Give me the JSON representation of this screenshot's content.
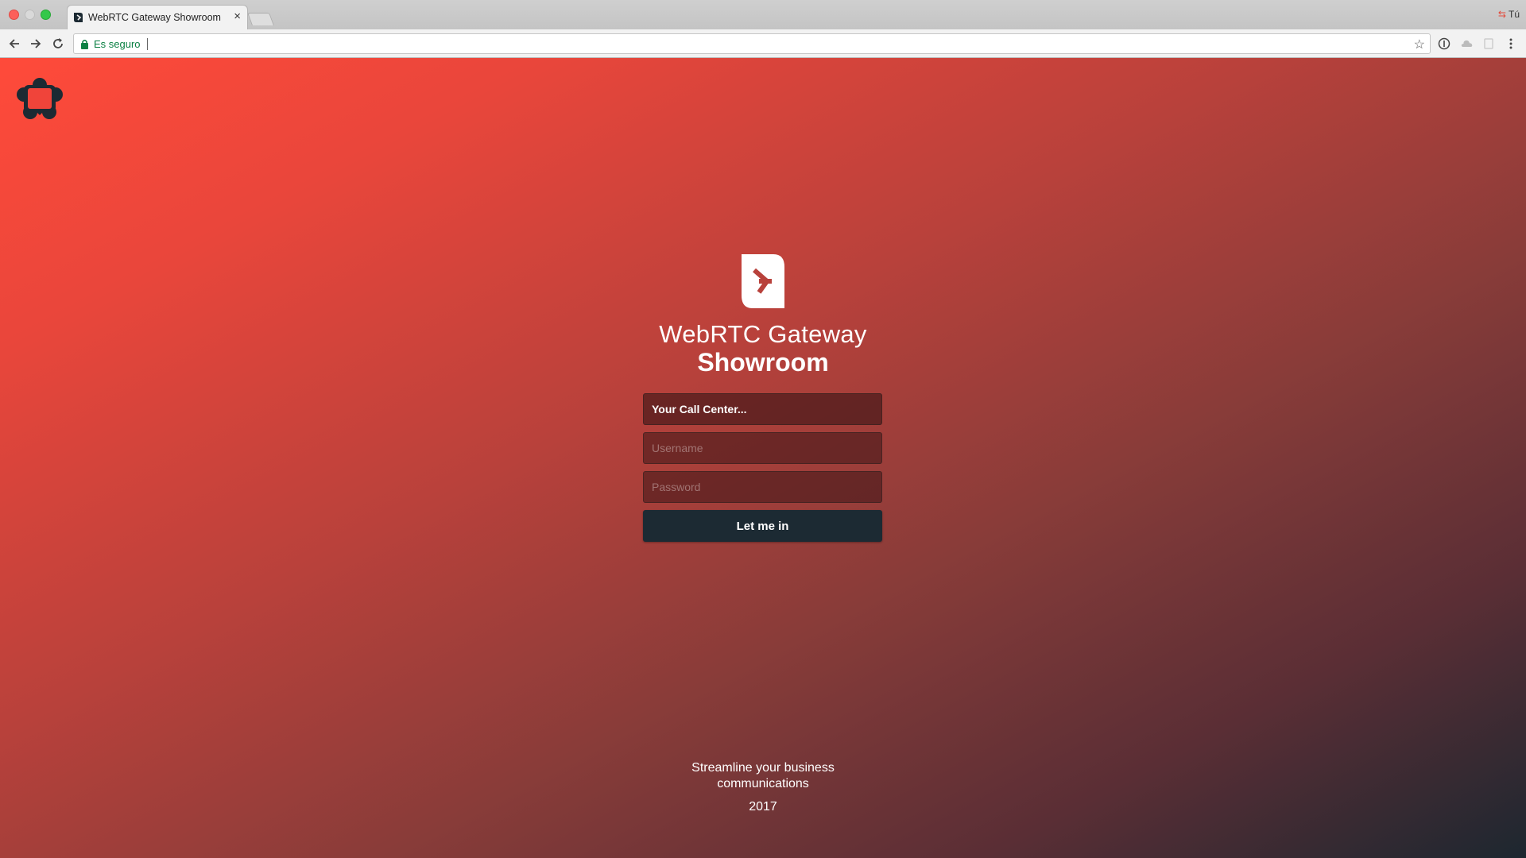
{
  "browser": {
    "tab_title": "WebRTC Gateway Showroom",
    "tab_close": "×",
    "profile_name": "Tú",
    "address": {
      "secure_label": "Es seguro",
      "url": ""
    }
  },
  "login": {
    "title_line1": "WebRTC Gateway",
    "title_line2": "Showroom",
    "company_value": "Your Call Center...",
    "username_placeholder": "Username",
    "password_placeholder": "Password",
    "submit_label": "Let me in"
  },
  "footer": {
    "tagline_line1": "Streamline your business",
    "tagline_line2": "communications",
    "year": "2017"
  },
  "colors": {
    "accent": "#ff4a3a",
    "button": "#1c2a33",
    "secure_green": "#0b8043"
  }
}
